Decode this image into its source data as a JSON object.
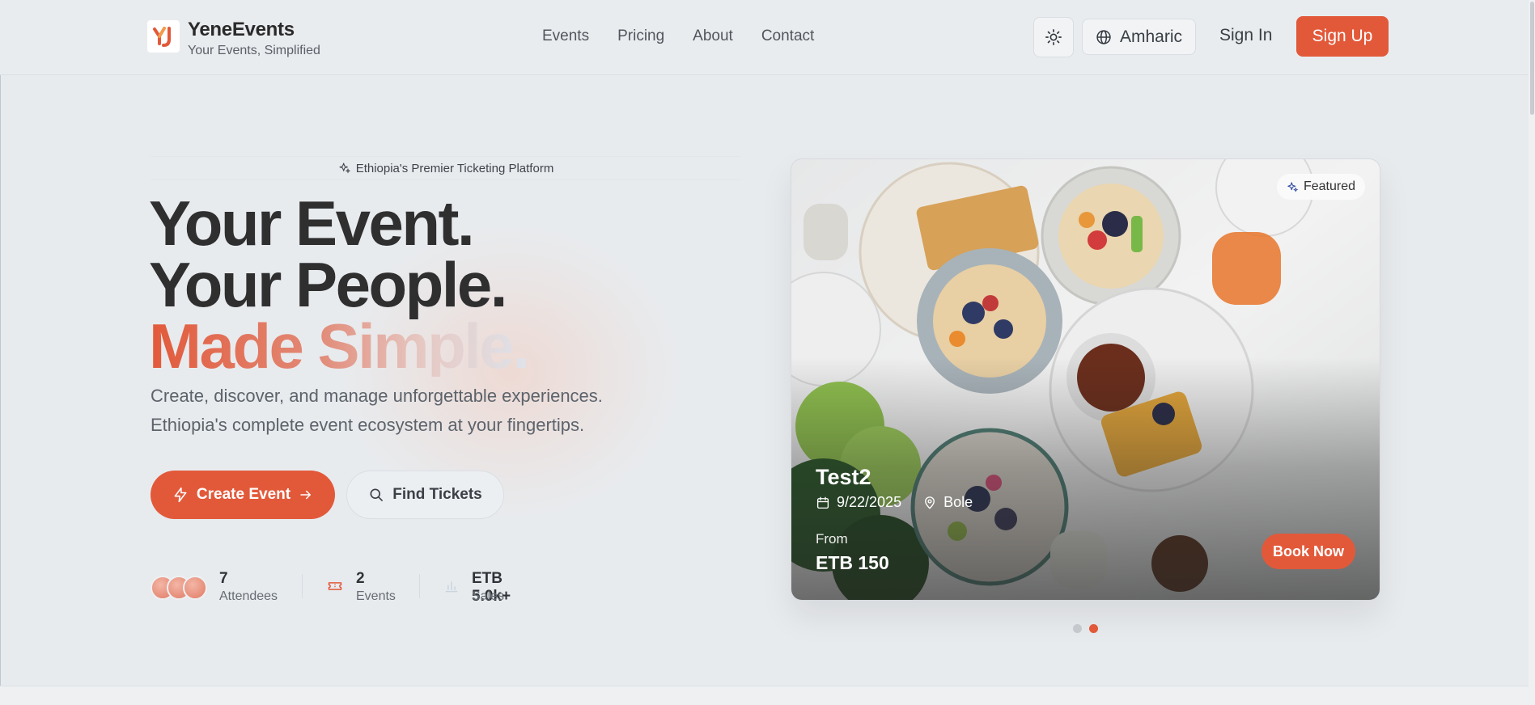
{
  "brand": {
    "name": "YeneEvents",
    "tagline": "Your Events, Simplified",
    "accent_color": "#e2593a"
  },
  "nav": {
    "items": [
      {
        "label": "Events"
      },
      {
        "label": "Pricing"
      },
      {
        "label": "About"
      },
      {
        "label": "Contact"
      }
    ]
  },
  "header": {
    "theme_icon": "sun-icon",
    "language_label": "Amharic",
    "signin_label": "Sign In",
    "signup_label": "Sign Up"
  },
  "hero": {
    "badge": "Ethiopia's Premier Ticketing Platform",
    "headline_line1": "Your Event.",
    "headline_line2": "Your People.",
    "headline_line3": "Made Simple.",
    "subtitle_line1": "Create, discover, and manage unforgettable experiences.",
    "subtitle_line2": "Ethiopia's complete event ecosystem at your fingertips.",
    "create_label": "Create Event",
    "find_label": "Find Tickets"
  },
  "stats": [
    {
      "value": "7",
      "label": "Attendees"
    },
    {
      "value": "2",
      "label": "Events"
    },
    {
      "value": "ETB 5.0k+",
      "label": "Sales"
    }
  ],
  "featured_event": {
    "badge": "Featured",
    "title": "Test2",
    "date": "9/22/2025",
    "location": "Bole",
    "from_label": "From",
    "price": "ETB 150",
    "book_label": "Book Now"
  },
  "carousel": {
    "count": 2,
    "active_index": 1
  }
}
